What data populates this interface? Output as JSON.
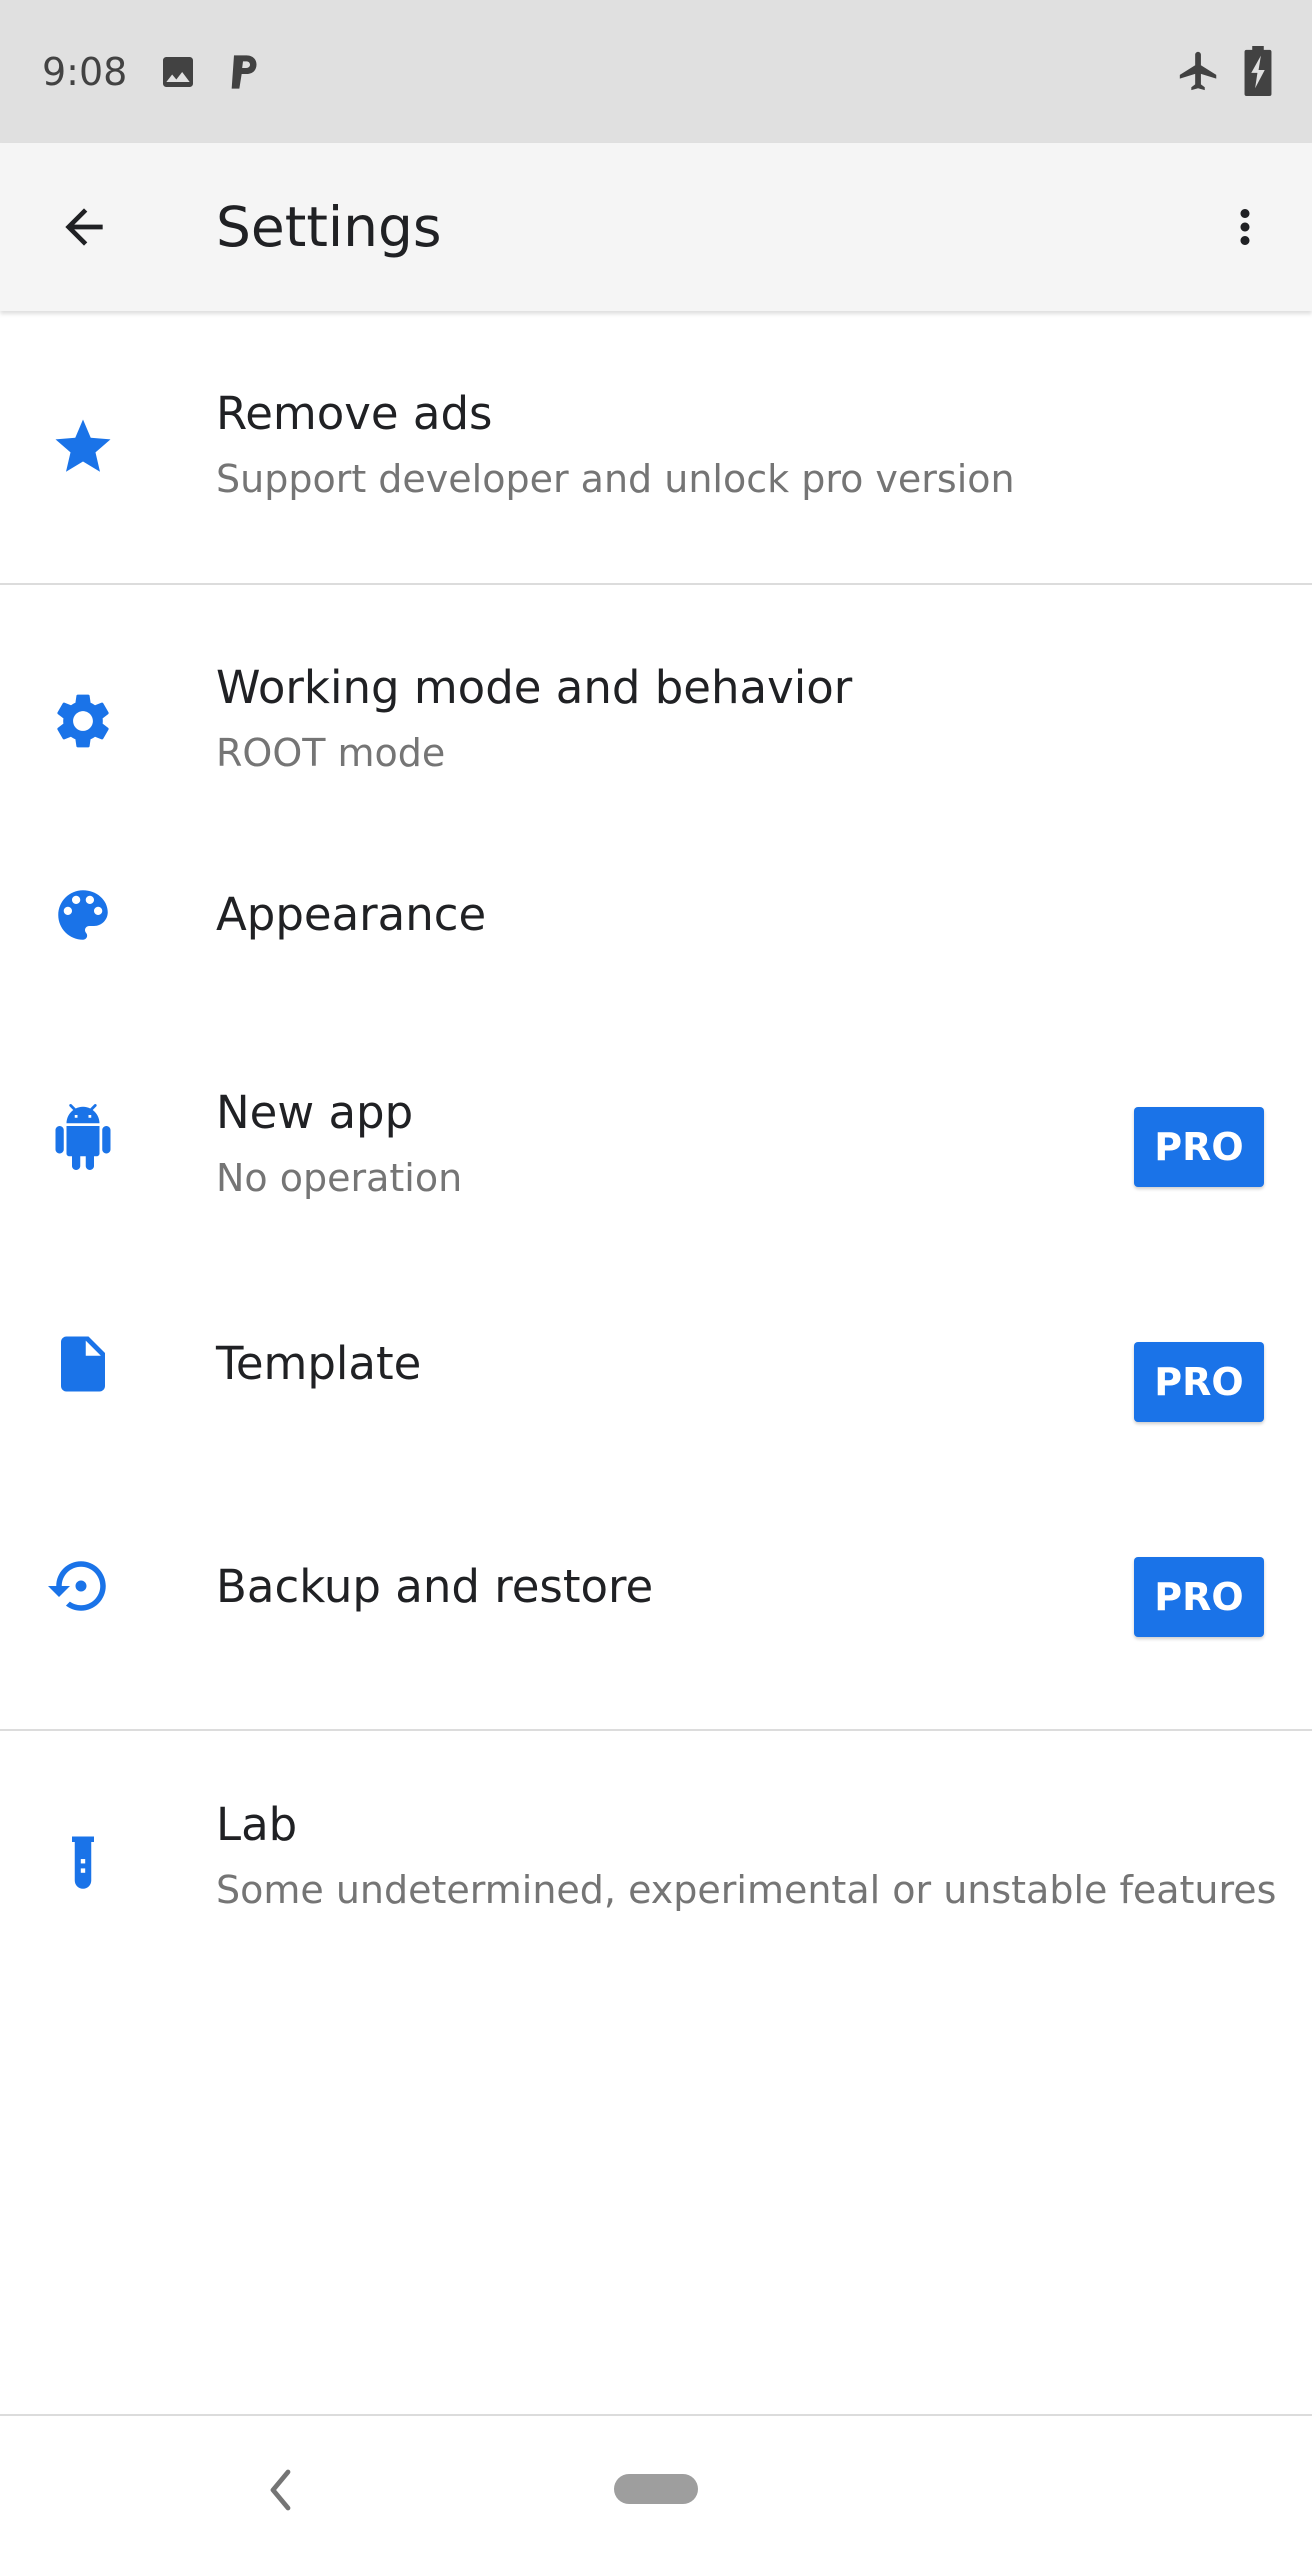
{
  "status_bar": {
    "time": "9:08",
    "icons": [
      "image-icon",
      "p-notification-icon",
      "airplane-mode-icon",
      "battery-charging-icon"
    ]
  },
  "app_bar": {
    "title": "Settings",
    "back_icon": "arrow-back-icon",
    "menu_icon": "more-vert-icon"
  },
  "settings": {
    "items": [
      {
        "icon": "star-icon",
        "title": "Remove ads",
        "summary": "Support developer and unlock pro version"
      },
      {
        "icon": "gear-icon",
        "title": "Working mode and behavior",
        "summary": "ROOT mode"
      },
      {
        "icon": "palette-icon",
        "title": "Appearance",
        "summary": ""
      },
      {
        "icon": "android-icon",
        "title": "New app",
        "summary": "No operation",
        "badge": "PRO"
      },
      {
        "icon": "document-icon",
        "title": "Template",
        "summary": "",
        "badge": "PRO"
      },
      {
        "icon": "backup-restore-icon",
        "title": "Backup and restore",
        "summary": "",
        "badge": "PRO"
      },
      {
        "icon": "test-tube-icon",
        "title": "Lab",
        "summary": "Some undetermined, experimental or unstable features"
      }
    ]
  },
  "nav_bar": {
    "back_icon": "chevron-left-icon",
    "home_icon": "home-pill-icon"
  },
  "colors": {
    "accent": "#1a73e8",
    "status_bar_bg": "#e0e0e0",
    "app_bar_bg": "#f5f5f5",
    "title_text": "#202124",
    "summary_text": "#757575",
    "divider": "#dcdcdc"
  }
}
